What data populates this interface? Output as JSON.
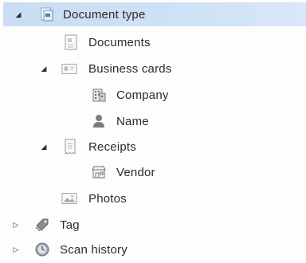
{
  "tree": {
    "document_type": {
      "label": "Document type",
      "icon": "document-type-icon",
      "expanded": true,
      "selected": true
    },
    "documents": {
      "label": "Documents",
      "icon": "documents-icon"
    },
    "business_cards": {
      "label": "Business cards",
      "icon": "business-card-icon",
      "expanded": true
    },
    "company": {
      "label": "Company",
      "icon": "company-building-icon"
    },
    "name": {
      "label": "Name",
      "icon": "person-icon"
    },
    "receipts": {
      "label": "Receipts",
      "icon": "receipt-icon",
      "expanded": true
    },
    "vendor": {
      "label": "Vendor",
      "icon": "storefront-icon"
    },
    "photos": {
      "label": "Photos",
      "icon": "photo-icon"
    },
    "tag": {
      "label": "Tag",
      "icon": "tag-icon",
      "expanded": false
    },
    "scan_history": {
      "label": "Scan history",
      "icon": "clock-history-icon",
      "expanded": false
    }
  },
  "colors": {
    "selection": "#cfe1f6",
    "icon_blue": "#4a7fb0",
    "icon_gray": "#8a8a8a"
  }
}
